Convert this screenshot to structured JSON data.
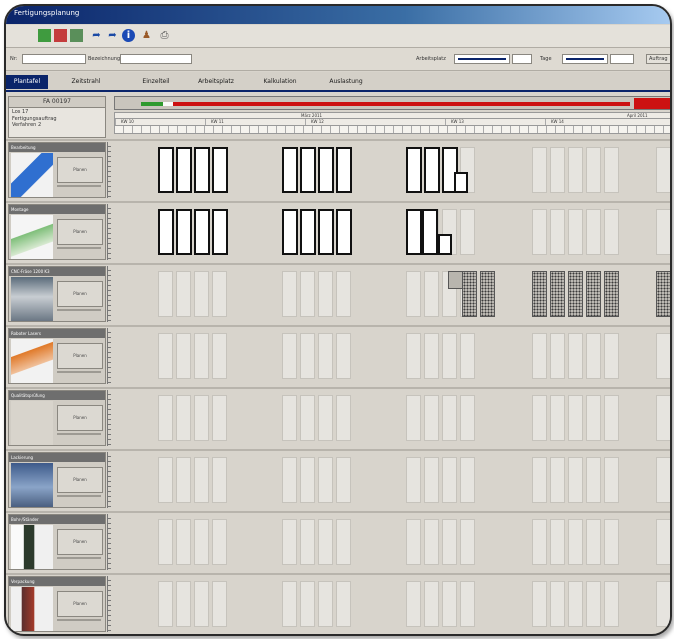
{
  "window": {
    "title": "Fertigungsplanung"
  },
  "toolbar": {
    "icons": [
      "grid-icon",
      "table-icon",
      "list-icon",
      "flag-left-icon",
      "flag-right-icon",
      "info-icon",
      "people-icon",
      "print-icon"
    ]
  },
  "filter": {
    "label1": "Nr:",
    "label2": "Bezeichnung",
    "label3": "Arbeitsplatz",
    "label4": "Tage",
    "label5": "Auftrag"
  },
  "tabs": [
    {
      "label": "Plantafel",
      "active": true
    },
    {
      "label": "Zeitstrahl",
      "active": false
    },
    {
      "label": "Einzelteil",
      "active": false
    },
    {
      "label": "Arbeitsplatz",
      "active": false
    },
    {
      "label": "Kalkulation",
      "active": false
    },
    {
      "label": "Auslastung",
      "active": false
    }
  ],
  "info": {
    "title": "FA 00197",
    "line1": "Los 17",
    "line2": "Fertigungsauftrag",
    "line3": "Verfahren 2"
  },
  "timeline": {
    "months": [
      "März 2011",
      "April 2011"
    ],
    "weeks": [
      "KW 10",
      "KW 11",
      "KW 12",
      "KW 13",
      "KW 14"
    ],
    "progress": 0.92,
    "accent": "#0a246a",
    "late_color": "#cc1111",
    "ok_color": "#2f9a2f"
  },
  "resources": [
    {
      "name": "Bearbeitung",
      "button": "Planen",
      "thumb": "blue-machine"
    },
    {
      "name": "Montage",
      "button": "Planen",
      "thumb": "green-machine"
    },
    {
      "name": "CNC-Fräse 1200 K3",
      "button": "Planen",
      "thumb": "cnc-machine"
    },
    {
      "name": "Roboter Lasers",
      "button": "Planen",
      "thumb": "orange-machine"
    },
    {
      "name": "Qualitätsprüfung",
      "button": "Planen",
      "thumb": "empty"
    },
    {
      "name": "Lackierung",
      "button": "Planen",
      "thumb": "blue-panel"
    },
    {
      "name": "Bohr-/Ständer",
      "button": "Planen",
      "thumb": "white-machine"
    },
    {
      "name": "Verpackung",
      "button": "Planen",
      "thumb": "red-machine"
    }
  ]
}
